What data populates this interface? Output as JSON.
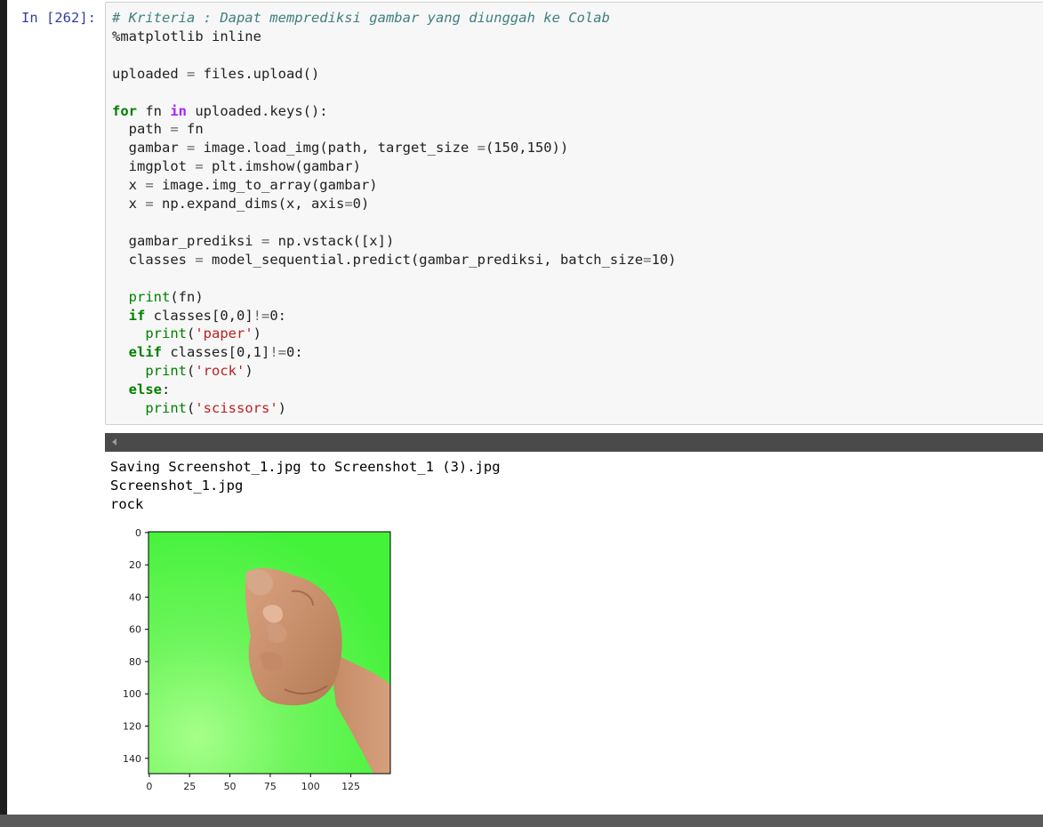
{
  "cell": {
    "prompt": "In [262]:",
    "code_lines": [
      [
        {
          "t": "# Kriteria : Dapat memprediksi gambar yang diunggah ke Colab",
          "c": "cm"
        }
      ],
      [
        {
          "t": "%matplotlib inline",
          "c": "nm"
        }
      ],
      [],
      [
        {
          "t": "uploaded ",
          "c": "nm"
        },
        {
          "t": "=",
          "c": "op"
        },
        {
          "t": " files.upload()",
          "c": "nm"
        }
      ],
      [],
      [
        {
          "t": "for",
          "c": "kw"
        },
        {
          "t": " fn ",
          "c": "nm"
        },
        {
          "t": "in",
          "c": "kw2"
        },
        {
          "t": " uploaded.keys():",
          "c": "nm"
        }
      ],
      [
        {
          "t": "  path ",
          "c": "nm"
        },
        {
          "t": "=",
          "c": "op"
        },
        {
          "t": " fn",
          "c": "nm"
        }
      ],
      [
        {
          "t": "  gambar ",
          "c": "nm"
        },
        {
          "t": "=",
          "c": "op"
        },
        {
          "t": " image.load_img(path, target_size ",
          "c": "nm"
        },
        {
          "t": "=",
          "c": "op"
        },
        {
          "t": "(150,150))",
          "c": "nm"
        }
      ],
      [
        {
          "t": "  imgplot ",
          "c": "nm"
        },
        {
          "t": "=",
          "c": "op"
        },
        {
          "t": " plt.imshow(gambar)",
          "c": "nm"
        }
      ],
      [
        {
          "t": "  x ",
          "c": "nm"
        },
        {
          "t": "=",
          "c": "op"
        },
        {
          "t": " image.img_to_array(gambar)",
          "c": "nm"
        }
      ],
      [
        {
          "t": "  x ",
          "c": "nm"
        },
        {
          "t": "=",
          "c": "op"
        },
        {
          "t": " np.expand_dims(x, axis",
          "c": "nm"
        },
        {
          "t": "=",
          "c": "op"
        },
        {
          "t": "0)",
          "c": "nm"
        }
      ],
      [],
      [
        {
          "t": "  gambar_prediksi ",
          "c": "nm"
        },
        {
          "t": "=",
          "c": "op"
        },
        {
          "t": " np.vstack([x])",
          "c": "nm"
        }
      ],
      [
        {
          "t": "  classes ",
          "c": "nm"
        },
        {
          "t": "=",
          "c": "op"
        },
        {
          "t": " model_sequential.predict(gambar_prediksi, batch_size",
          "c": "nm"
        },
        {
          "t": "=",
          "c": "op"
        },
        {
          "t": "10)",
          "c": "nm"
        }
      ],
      [],
      [
        {
          "t": "  ",
          "c": "nm"
        },
        {
          "t": "print",
          "c": "bi"
        },
        {
          "t": "(fn)",
          "c": "nm"
        }
      ],
      [
        {
          "t": "  ",
          "c": "nm"
        },
        {
          "t": "if",
          "c": "kw"
        },
        {
          "t": " classes[0,0]",
          "c": "nm"
        },
        {
          "t": "!=",
          "c": "op"
        },
        {
          "t": "0:",
          "c": "nm"
        }
      ],
      [
        {
          "t": "    ",
          "c": "nm"
        },
        {
          "t": "print",
          "c": "bi"
        },
        {
          "t": "(",
          "c": "nm"
        },
        {
          "t": "'paper'",
          "c": "st"
        },
        {
          "t": ")",
          "c": "nm"
        }
      ],
      [
        {
          "t": "  ",
          "c": "nm"
        },
        {
          "t": "elif",
          "c": "kw"
        },
        {
          "t": " classes[0,1]",
          "c": "nm"
        },
        {
          "t": "!=",
          "c": "op"
        },
        {
          "t": "0:",
          "c": "nm"
        }
      ],
      [
        {
          "t": "    ",
          "c": "nm"
        },
        {
          "t": "print",
          "c": "bi"
        },
        {
          "t": "(",
          "c": "nm"
        },
        {
          "t": "'rock'",
          "c": "st"
        },
        {
          "t": ")",
          "c": "nm"
        }
      ],
      [
        {
          "t": "  ",
          "c": "nm"
        },
        {
          "t": "else",
          "c": "kw"
        },
        {
          "t": ":",
          "c": "nm"
        }
      ],
      [
        {
          "t": "    ",
          "c": "nm"
        },
        {
          "t": "print",
          "c": "bi"
        },
        {
          "t": "(",
          "c": "nm"
        },
        {
          "t": "'scissors'",
          "c": "st"
        },
        {
          "t": ")",
          "c": "nm"
        }
      ]
    ]
  },
  "output": {
    "lines": [
      "Saving Screenshot_1.jpg to Screenshot_1 (3).jpg",
      "Screenshot_1.jpg",
      "rock"
    ]
  },
  "plot": {
    "x_ticks": [
      "0",
      "25",
      "50",
      "75",
      "100",
      "125"
    ],
    "y_ticks": [
      "0",
      "20",
      "40",
      "60",
      "80",
      "100",
      "120",
      "140"
    ],
    "image_subject": "fist-on-green-background",
    "background_color": "#44f23a"
  },
  "colors": {
    "prompt": "#303f9f",
    "comment": "#408080",
    "keyword": "#008000",
    "keyword_in": "#aa22ff",
    "string": "#ba2121"
  }
}
